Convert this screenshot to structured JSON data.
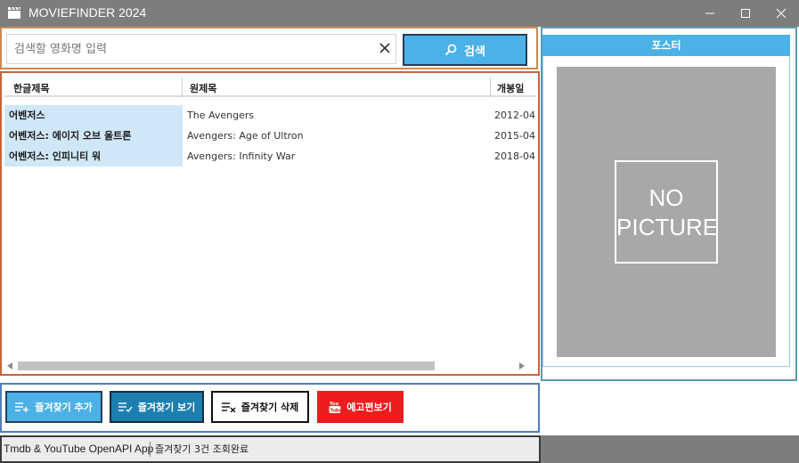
{
  "window": {
    "title": "MOVIEFINDER 2024",
    "minimize_icon": "minimize-icon",
    "maximize_icon": "maximize-icon",
    "close_icon": "close-icon"
  },
  "search": {
    "placeholder": "검색할 영화명 입력",
    "value": "",
    "clear_icon": "clear-icon",
    "button_label": "검색",
    "button_icon": "search-icon"
  },
  "table": {
    "columns": [
      "한글제목",
      "원제목",
      "개봉일"
    ],
    "rows": [
      {
        "kor_title": "어벤저스",
        "orig_title": "The Avengers",
        "release": "2012-04"
      },
      {
        "kor_title": "어벤저스: 에이지 오브 울트론",
        "orig_title": "Avengers: Age of Ultron",
        "release": "2015-04"
      },
      {
        "kor_title": "어벤저스: 인피니티 워",
        "orig_title": "Avengers: Infinity War",
        "release": "2018-04"
      }
    ]
  },
  "poster": {
    "header": "포스터",
    "placeholder_line1": "NO",
    "placeholder_line2": "PICTURE"
  },
  "buttons": {
    "add_favorite": "즐겨찾기 추가",
    "view_favorite": "즐겨찾기 보기",
    "delete_favorite": "즐겨찾기 삭제",
    "trailer": "예고편보기"
  },
  "status": {
    "app": "Tmdb & YouTube OpenAPI App",
    "message": "즐겨찾기 3건 조회완료"
  },
  "colors": {
    "accent_blue": "#4bb1e7",
    "dark_blue": "#1c7faf",
    "youtube_red": "#ee1c1c",
    "titlebar_gray": "#7d7d7d"
  }
}
